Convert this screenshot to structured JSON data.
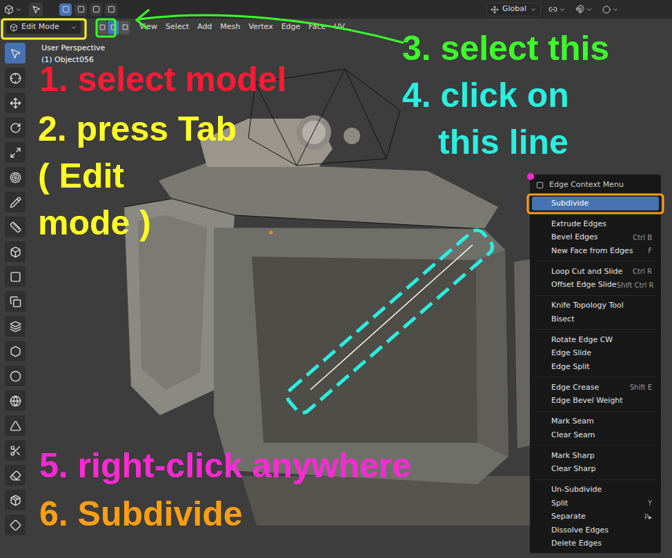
{
  "header": {
    "global_dropdown": "Global",
    "mode_dropdown": "Edit Mode",
    "select_modes": [
      {
        "selected": false
      },
      {
        "selected": true
      },
      {
        "selected": false
      }
    ],
    "menus": [
      "View",
      "Select",
      "Add",
      "Mesh",
      "Vertex",
      "Edge",
      "Face",
      "UV"
    ]
  },
  "viewport": {
    "view_name": "User Perspective",
    "object_name": "(1) Object056"
  },
  "toolbar": {
    "tools": [
      {
        "selected": true
      },
      {
        "selected": false
      },
      {
        "selected": false
      },
      {
        "selected": false
      },
      {
        "selected": false
      },
      {
        "selected": false
      },
      {
        "selected": false
      },
      {
        "selected": false
      },
      {
        "selected": false
      },
      {
        "selected": false
      },
      {
        "selected": false
      },
      {
        "selected": false
      },
      {
        "selected": false
      },
      {
        "selected": false
      },
      {
        "selected": false
      },
      {
        "selected": false
      },
      {
        "selected": false
      },
      {
        "selected": false
      },
      {
        "selected": false
      },
      {
        "selected": false
      }
    ]
  },
  "annotations": [
    {
      "lines": [
        "1. select model"
      ],
      "color": "#ff1a35"
    },
    {
      "lines": [
        "2. press Tab",
        "( Edit",
        "mode )"
      ],
      "color": "#ffff28"
    },
    {
      "lines": [
        "3. select this"
      ],
      "color": "#3cff2c"
    },
    {
      "lines": [
        "4. click on",
        "this line"
      ],
      "color": "#2af0e0"
    },
    {
      "lines": [
        "5. right-click anywhere"
      ],
      "color": "#ff2ad4"
    },
    {
      "lines": [
        "6. Subdivide"
      ],
      "color": "#ff9f14"
    }
  ],
  "context_menu": {
    "title": "Edge Context Menu",
    "groups": [
      [
        {
          "label": "Subdivide",
          "shortcut": "",
          "selected": true
        }
      ],
      [
        {
          "label": "Extrude Edges",
          "shortcut": "",
          "selected": false
        },
        {
          "label": "Bevel Edges",
          "shortcut": "Ctrl B",
          "selected": false
        },
        {
          "label": "New Face from Edges",
          "shortcut": "F",
          "selected": false
        }
      ],
      [
        {
          "label": "Loop Cut and Slide",
          "shortcut": "Ctrl R",
          "selected": false
        },
        {
          "label": "Offset Edge Slide",
          "shortcut": "Shift Ctrl R",
          "selected": false
        }
      ],
      [
        {
          "label": "Knife Topology Tool",
          "shortcut": "",
          "selected": false
        },
        {
          "label": "Bisect",
          "shortcut": "",
          "selected": false
        }
      ],
      [
        {
          "label": "Rotate Edge CW",
          "shortcut": "",
          "selected": false
        },
        {
          "label": "Edge Slide",
          "shortcut": "",
          "selected": false
        },
        {
          "label": "Edge Split",
          "shortcut": "",
          "selected": false
        }
      ],
      [
        {
          "label": "Edge Crease",
          "shortcut": "Shift E",
          "selected": false
        },
        {
          "label": "Edge Bevel Weight",
          "shortcut": "",
          "selected": false
        }
      ],
      [
        {
          "label": "Mark Seam",
          "shortcut": "",
          "selected": false
        },
        {
          "label": "Clear Seam",
          "shortcut": "",
          "selected": false
        }
      ],
      [
        {
          "label": "Mark Sharp",
          "shortcut": "",
          "selected": false
        },
        {
          "label": "Clear Sharp",
          "shortcut": "",
          "selected": false
        }
      ],
      [
        {
          "label": "Un-Subdivide",
          "shortcut": "",
          "selected": false
        },
        {
          "label": "Split",
          "shortcut": "Y",
          "selected": false
        },
        {
          "label": "Separate",
          "shortcut": "P",
          "arrow": "▸",
          "selected": false
        },
        {
          "label": "Dissolve Edges",
          "shortcut": "",
          "selected": false
        },
        {
          "label": "Delete Edges",
          "shortcut": "",
          "selected": false
        }
      ]
    ]
  }
}
